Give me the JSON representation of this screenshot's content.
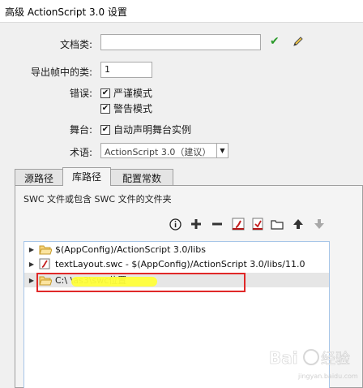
{
  "window": {
    "title": "高级 ActionScript 3.0 设置"
  },
  "form": {
    "doc_class_label": "文档类:",
    "doc_class_value": "",
    "export_frame_label": "导出帧中的类:",
    "export_frame_value": "1",
    "errors_label": "错误:",
    "strict_mode_label": "严谨模式",
    "strict_mode_checked": true,
    "warnings_mode_label": "警告模式",
    "warnings_mode_checked": true,
    "stage_label": "舞台:",
    "auto_declare_label": "自动声明舞台实例",
    "auto_declare_checked": true,
    "dialect_label": "术语:",
    "dialect_value": "ActionScript 3.0（建议）"
  },
  "tabs": [
    {
      "label": "源路径",
      "active": false
    },
    {
      "label": "库路径",
      "active": true
    },
    {
      "label": "配置常数",
      "active": false
    }
  ],
  "library_panel": {
    "caption": "SWC 文件或包含 SWC 文件的文件夹",
    "toolbar": [
      "info-icon",
      "add-icon",
      "remove-icon",
      "flash-swc-icon",
      "swc-file-icon",
      "folder-icon",
      "move-up-icon",
      "move-down-icon"
    ],
    "entries": [
      {
        "icon": "folder-icon",
        "text": "$(AppConfig)/ActionScript 3.0/libs",
        "selected": false
      },
      {
        "icon": "swc-file-icon",
        "text": "textLayout.swc - $(AppConfig)/ActionScript 3.0/libs/11.0",
        "selected": false
      },
      {
        "icon": "folder-icon",
        "text": "C:\\                                          \\as3\\swc位置",
        "selected": true
      }
    ]
  },
  "watermark": {
    "text": "Baidu 经验",
    "subtext": "jingyan.baidu.com"
  },
  "colors": {
    "highlight": "#e02828",
    "redaction": "#ffff3a",
    "check": "#2a9a2a"
  }
}
